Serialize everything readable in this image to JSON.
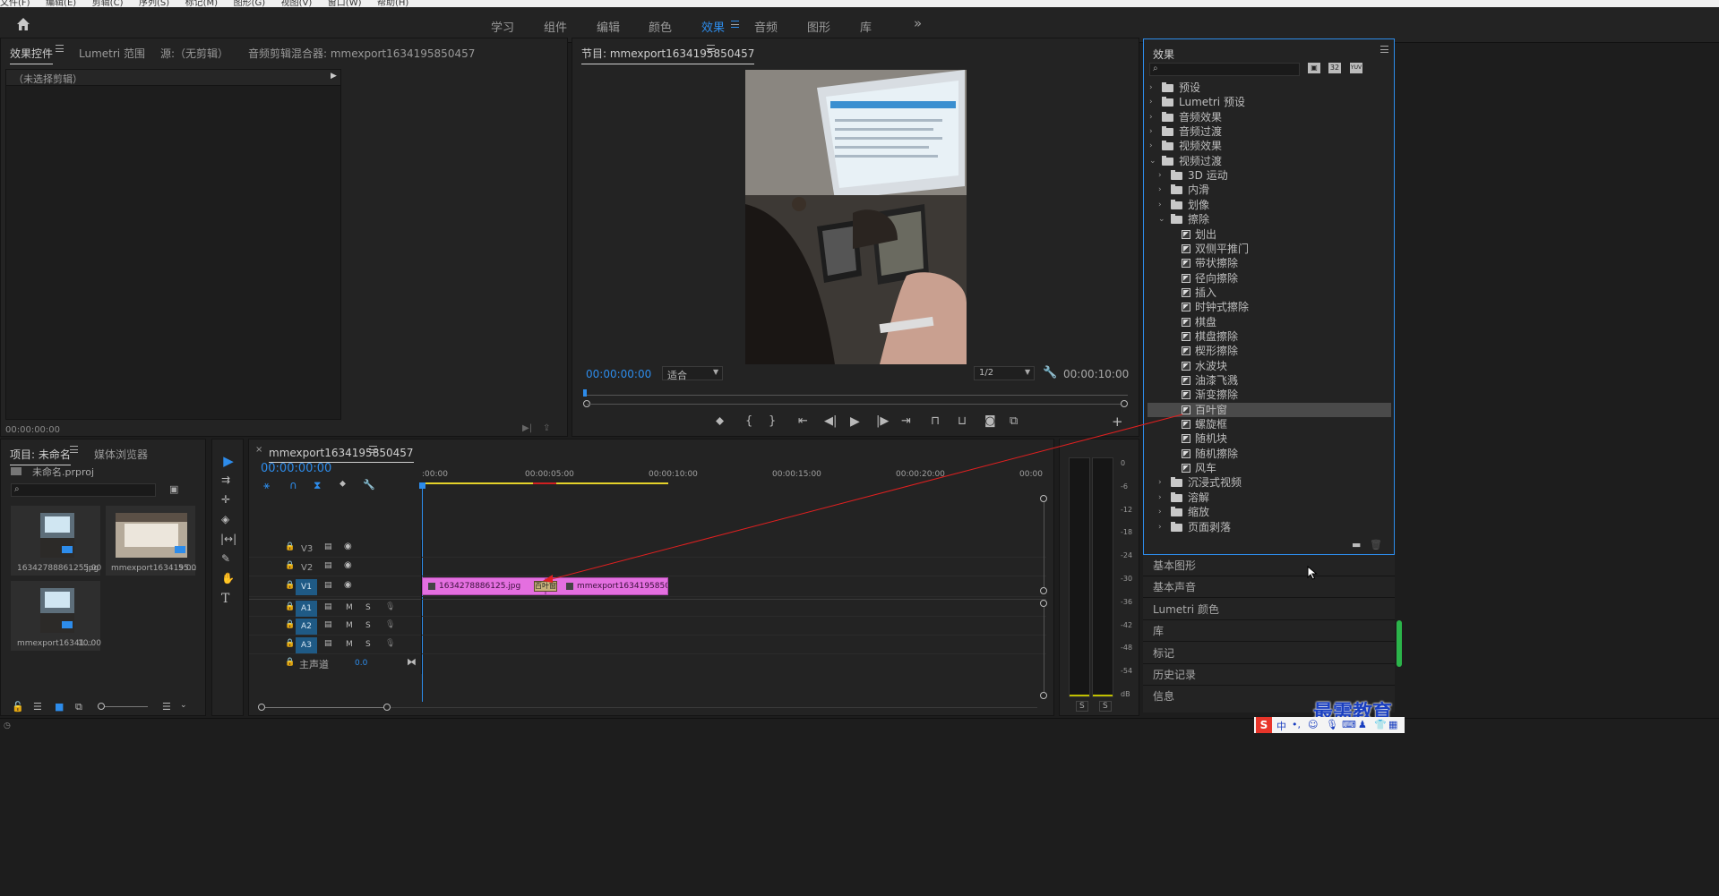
{
  "menubar": {
    "items": [
      "文件(F)",
      "编辑(E)",
      "剪辑(C)",
      "序列(S)",
      "标记(M)",
      "图形(G)",
      "视图(V)",
      "窗口(W)",
      "帮助(H)"
    ]
  },
  "workspaces": {
    "tabs": [
      "学习",
      "组件",
      "编辑",
      "颜色",
      "效果",
      "音频",
      "图形",
      "库"
    ],
    "active": "效果",
    "more": "»"
  },
  "effect_controls": {
    "tabs": [
      "效果控件",
      "Lumetri 范围",
      "源:（无剪辑）",
      "音频剪辑混合器: mmexport1634195850457"
    ],
    "no_clip": "（未选择剪辑）",
    "timecode": "00:00:00:00"
  },
  "program_monitor": {
    "title": "节目: mmexport1634195850457",
    "timecode_left": "00:00:00:00",
    "fit": "适合",
    "resolution": "1/2",
    "timecode_right": "00:00:10:00"
  },
  "effects_panel": {
    "title": "效果",
    "search_placeholder": "",
    "badges": [
      "32",
      "YUV"
    ],
    "tree": [
      {
        "label": "预设",
        "level": 0,
        "type": "folder",
        "expanded": false,
        "star": true
      },
      {
        "label": "Lumetri 预设",
        "level": 0,
        "type": "folder",
        "expanded": false,
        "star": true
      },
      {
        "label": "音频效果",
        "level": 0,
        "type": "folder",
        "expanded": false
      },
      {
        "label": "音频过渡",
        "level": 0,
        "type": "folder",
        "expanded": false
      },
      {
        "label": "视频效果",
        "level": 0,
        "type": "folder",
        "expanded": false
      },
      {
        "label": "视频过渡",
        "level": 0,
        "type": "folder",
        "expanded": true
      },
      {
        "label": "3D 运动",
        "level": 1,
        "type": "folder",
        "expanded": false
      },
      {
        "label": "内滑",
        "level": 1,
        "type": "folder",
        "expanded": false
      },
      {
        "label": "划像",
        "level": 1,
        "type": "folder",
        "expanded": false
      },
      {
        "label": "擦除",
        "level": 1,
        "type": "folder",
        "expanded": true
      },
      {
        "label": "划出",
        "level": 2,
        "type": "fx"
      },
      {
        "label": "双侧平推门",
        "level": 2,
        "type": "fx"
      },
      {
        "label": "带状擦除",
        "level": 2,
        "type": "fx"
      },
      {
        "label": "径向擦除",
        "level": 2,
        "type": "fx"
      },
      {
        "label": "插入",
        "level": 2,
        "type": "fx"
      },
      {
        "label": "时钟式擦除",
        "level": 2,
        "type": "fx"
      },
      {
        "label": "棋盘",
        "level": 2,
        "type": "fx"
      },
      {
        "label": "棋盘擦除",
        "level": 2,
        "type": "fx"
      },
      {
        "label": "楔形擦除",
        "level": 2,
        "type": "fx"
      },
      {
        "label": "水波块",
        "level": 2,
        "type": "fx"
      },
      {
        "label": "油漆飞溅",
        "level": 2,
        "type": "fx"
      },
      {
        "label": "渐变擦除",
        "level": 2,
        "type": "fx"
      },
      {
        "label": "百叶窗",
        "level": 2,
        "type": "fx",
        "selected": true
      },
      {
        "label": "螺旋框",
        "level": 2,
        "type": "fx"
      },
      {
        "label": "随机块",
        "level": 2,
        "type": "fx"
      },
      {
        "label": "随机擦除",
        "level": 2,
        "type": "fx"
      },
      {
        "label": "风车",
        "level": 2,
        "type": "fx"
      },
      {
        "label": "沉浸式视频",
        "level": 1,
        "type": "folder",
        "expanded": false
      },
      {
        "label": "溶解",
        "level": 1,
        "type": "folder",
        "expanded": false
      },
      {
        "label": "缩放",
        "level": 1,
        "type": "folder",
        "expanded": false
      },
      {
        "label": "页面剥落",
        "level": 1,
        "type": "folder",
        "expanded": false
      }
    ]
  },
  "side_panels": [
    "基本图形",
    "基本声音",
    "Lumetri 颜色",
    "库",
    "标记",
    "历史记录",
    "信息"
  ],
  "project_panel": {
    "tabs": [
      "项目: 未命名",
      "媒体浏览器"
    ],
    "project_file": "未命名.prproj",
    "items": [
      {
        "name": "1634278886125.jpg",
        "duration": "5:00"
      },
      {
        "name": "mmexport1634195...",
        "duration": "5:00"
      },
      {
        "name": "mmexport16341...",
        "duration": "10:00"
      }
    ]
  },
  "timeline": {
    "sequence_name": "mmexport1634195850457",
    "timecode": "00:00:00:00",
    "ruler_labels": [
      ":00:00",
      "00:00:05:00",
      "00:00:10:00",
      "00:00:15:00",
      "00:00:20:00",
      "00:00"
    ],
    "video_tracks": [
      "V3",
      "V2",
      "V1"
    ],
    "audio_tracks": [
      "A1",
      "A2",
      "A3"
    ],
    "master": {
      "label": "主声道",
      "value": "0.0"
    },
    "clips": [
      {
        "name": "1634278886125.jpg",
        "track": "V1"
      },
      {
        "name": "mmexport1634195850457.jp",
        "track": "V1"
      }
    ],
    "transition_label": "百叶窗"
  },
  "audio_meter": {
    "scale": [
      "0",
      "-6",
      "-12",
      "-18",
      "-24",
      "-30",
      "-36",
      "-42",
      "-48",
      "-54",
      "dB"
    ],
    "solo": [
      "S",
      "S"
    ]
  },
  "watermark": "最需教育",
  "colors": {
    "accent": "#2d8ceb",
    "clip": "#e46fe0",
    "track_active": "#1f5a85",
    "arrow": "#e02020"
  }
}
